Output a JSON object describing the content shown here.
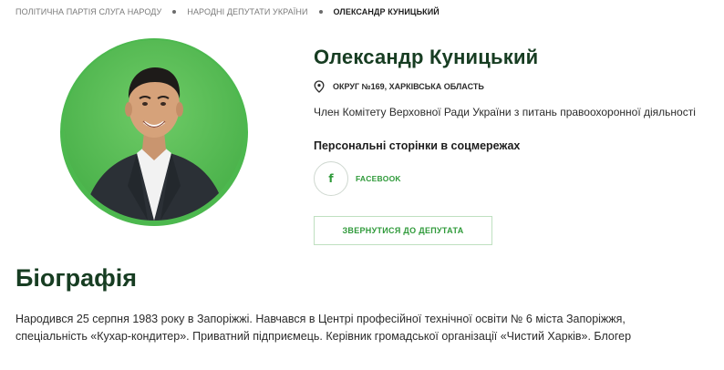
{
  "breadcrumb": [
    {
      "label": "ПОЛІТИЧНА ПАРТІЯ СЛУГА НАРОДУ"
    },
    {
      "label": "НАРОДНІ ДЕПУТАТИ УКРАЇНИ"
    },
    {
      "label": "ОЛЕКСАНДР КУНИЦЬКИЙ"
    }
  ],
  "profile": {
    "name": "Олександр Куницький",
    "district": "ОКРУГ №169, ХАРКІВСЬКА ОБЛАСТЬ",
    "committee": "Член Комітету Верховної Ради України з питань правоохоронної діяльності",
    "social_title": "Персональні сторінки в соцмережах",
    "facebook_label": "FACEBOOK",
    "contact_button": "ЗВЕРНУТИСЯ ДО ДЕПУТАТА"
  },
  "biography": {
    "title": "Біографія",
    "text": "Народився 25 серпня 1983 року в Запоріжжі. Навчався в Центрі професійної технічної освіти № 6 міста Запоріжжя, спеціальність «Кухар-кондитер». Приватний підприємець. Керівник громадської організації «Чистий Харків». Блогер"
  },
  "icons": {
    "location": "map-pin-icon",
    "facebook": "facebook-icon"
  },
  "colors": {
    "brand_green": "#2f9a3a",
    "heading_dark_green": "#173d22",
    "portrait_bg": "#4cb84e"
  }
}
